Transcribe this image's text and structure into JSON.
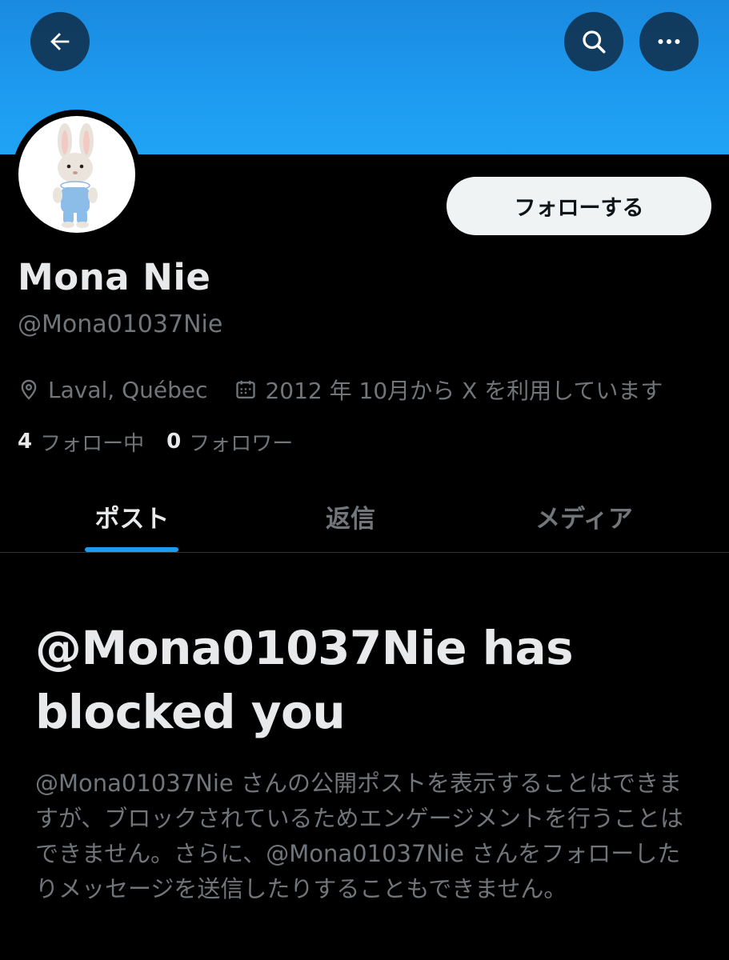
{
  "header": {
    "back_icon": "arrow-left-icon",
    "search_icon": "search-icon",
    "more_icon": "more-horizontal-icon",
    "banner_color": "#1d9bf0"
  },
  "profile": {
    "avatar": "white-rabbit-figurine-avatar",
    "follow_label": "フォローする",
    "display_name": "Mona Nie",
    "handle": "@Mona01037Nie",
    "location": "Laval, Québec",
    "joined": "2012 年 10月から X を利用しています",
    "following_count": "4",
    "following_label": "フォロー中",
    "followers_count": "0",
    "followers_label": "フォロワー"
  },
  "tabs": [
    {
      "label": "ポスト",
      "active": true
    },
    {
      "label": "返信",
      "active": false
    },
    {
      "label": "メディア",
      "active": false
    }
  ],
  "blocked": {
    "title": "@Mona01037Nie has blocked you",
    "description": "@Mona01037Nie さんの公開ポストを表示することはできますが、ブロックされているためエンゲージメントを行うことはできません。さらに、@Mona01037Nie さんをフォローしたりメッセージを送信したりすることもできません。"
  },
  "colors": {
    "accent": "#1d9bf0",
    "background": "#000000",
    "text_primary": "#e7e9ea",
    "text_secondary": "#71767b"
  }
}
